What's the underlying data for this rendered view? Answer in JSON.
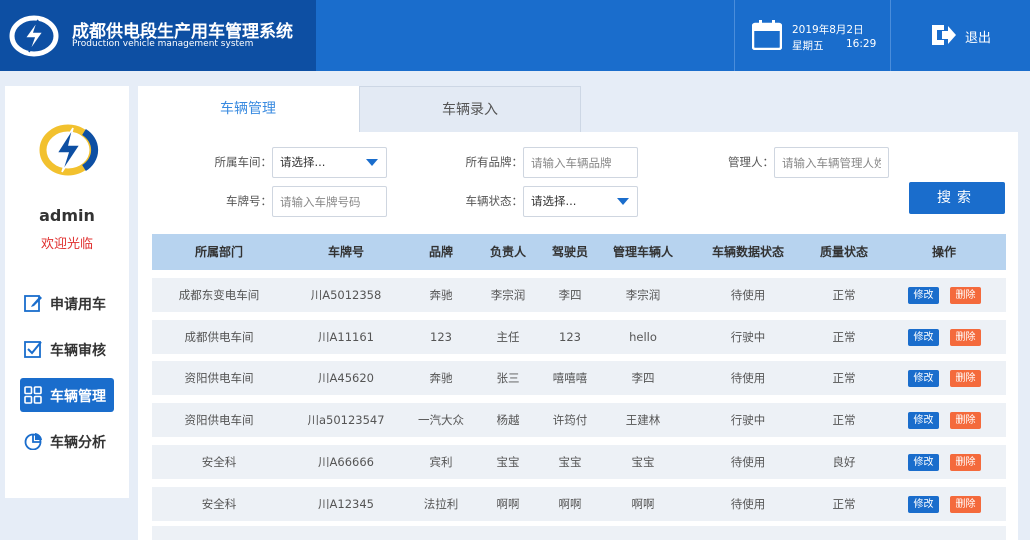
{
  "header": {
    "title": "成都供电段生产用车管理系统",
    "subtitle": "Production vehicle management system",
    "date": "2019年8月2日",
    "weekday": "星期五",
    "time": "16:29",
    "logout_label": "退出"
  },
  "sidebar": {
    "username": "admin",
    "welcome": "欢迎光临",
    "items": [
      {
        "label": "申请用车",
        "icon": "edit-icon"
      },
      {
        "label": "车辆审核",
        "icon": "checkbox-icon"
      },
      {
        "label": "车辆管理",
        "icon": "grid-icon"
      },
      {
        "label": "车辆分析",
        "icon": "pie-chart-icon"
      }
    ],
    "active_index": 2
  },
  "tabs": [
    {
      "label": "车辆管理",
      "active": true
    },
    {
      "label": "车辆录入",
      "active": false
    }
  ],
  "filters": {
    "workshop": {
      "label": "所属车间：",
      "value": "请选择..."
    },
    "brand": {
      "label": "所有品牌：",
      "placeholder": "请输入车辆品牌"
    },
    "manager": {
      "label": "管理人：",
      "placeholder": "请输入车辆管理人姓"
    },
    "plate": {
      "label": "车牌号：",
      "placeholder": "请输入车牌号码"
    },
    "status": {
      "label": "车辆状态：",
      "value": "请选择..."
    },
    "search_label": "搜索"
  },
  "table": {
    "columns": [
      "所属部门",
      "车牌号",
      "品牌",
      "负责人",
      "驾驶员",
      "管理车辆人",
      "车辆数据状态",
      "质量状态",
      "操作"
    ],
    "edit_label": "修改",
    "delete_label": "删除",
    "rows": [
      [
        "成都东变电车间",
        "川A5012358",
        "奔驰",
        "李宗润",
        "李四",
        "李宗润",
        "待使用",
        "正常"
      ],
      [
        "成都供电车间",
        "川A11161",
        "123",
        "主任",
        "123",
        "hello",
        "行驶中",
        "正常"
      ],
      [
        "资阳供电车间",
        "川A45620",
        "奔驰",
        "张三",
        "嘻嘻嘻",
        "李四",
        "待使用",
        "正常"
      ],
      [
        "资阳供电车间",
        "川a50123547",
        "一汽大众",
        "杨越",
        "许筠付",
        "王建林",
        "行驶中",
        "正常"
      ],
      [
        "安全科",
        "川A66666",
        "宾利",
        "宝宝",
        "宝宝",
        "宝宝",
        "待使用",
        "良好"
      ],
      [
        "安全科",
        "川A12345",
        "法拉利",
        "啊啊",
        "啊啊",
        "啊啊",
        "待使用",
        "正常"
      ]
    ]
  },
  "colors": {
    "header_blue": "#1a6dcc",
    "brand_dark_blue": "#0d4fa3",
    "table_header": "#b7d3ef",
    "delete_orange": "#f46a3c",
    "welcome_red": "#e0302f"
  }
}
